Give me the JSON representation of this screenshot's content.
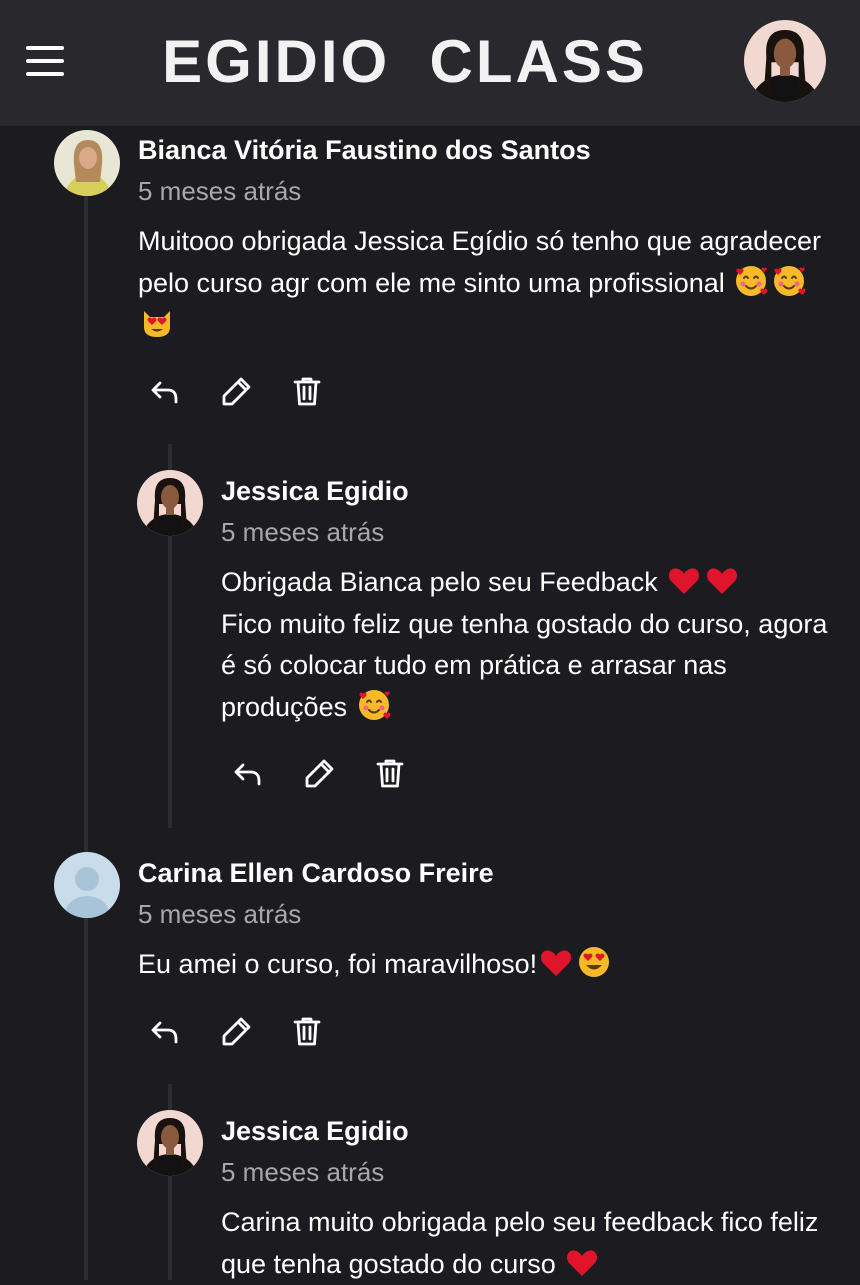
{
  "header": {
    "brand": "EGIDIO  CLASS",
    "menu_icon": "hamburger-menu-icon",
    "profile_icon": "user-avatar"
  },
  "colors": {
    "background": "#1c1b1f",
    "header_bg": "#29282c",
    "text": "#ffffff",
    "muted": "#a8a7ab",
    "heart": "#e0142b"
  },
  "comments": [
    {
      "author": "Bianca Vitória Faustino dos Santos",
      "time": "5 meses atrás",
      "text": "Muitooo obrigada Jessica Egídio só tenho que agradecer pelo curso agr com ele me sinto uma profissional",
      "emojis": [
        "smiling-face-with-hearts",
        "smiling-face-with-hearts",
        "heart-eyes-cat"
      ],
      "actions": [
        "reply-icon",
        "edit-icon",
        "delete-icon"
      ],
      "reply": {
        "author": "Jessica Egidio",
        "time": "5 meses atrás",
        "line1": "Obrigada Bianca pelo seu Feedback",
        "line2": "Fico muito feliz que tenha gostado do curso, agora é só colocar tudo em prática e arrasar nas produções",
        "actions": [
          "reply-icon",
          "edit-icon",
          "delete-icon"
        ]
      }
    },
    {
      "author": "Carina Ellen Cardoso Freire",
      "time": "5 meses atrás",
      "text": "Eu amei o curso, foi maravilhoso!",
      "emojis": [
        "red-heart",
        "heart-eyes"
      ],
      "actions": [
        "reply-icon",
        "edit-icon",
        "delete-icon"
      ],
      "reply": {
        "author": "Jessica Egidio",
        "time": "5 meses atrás",
        "text": "Carina muito obrigada pelo seu feedback fico feliz que tenha gostado do curso"
      }
    }
  ]
}
